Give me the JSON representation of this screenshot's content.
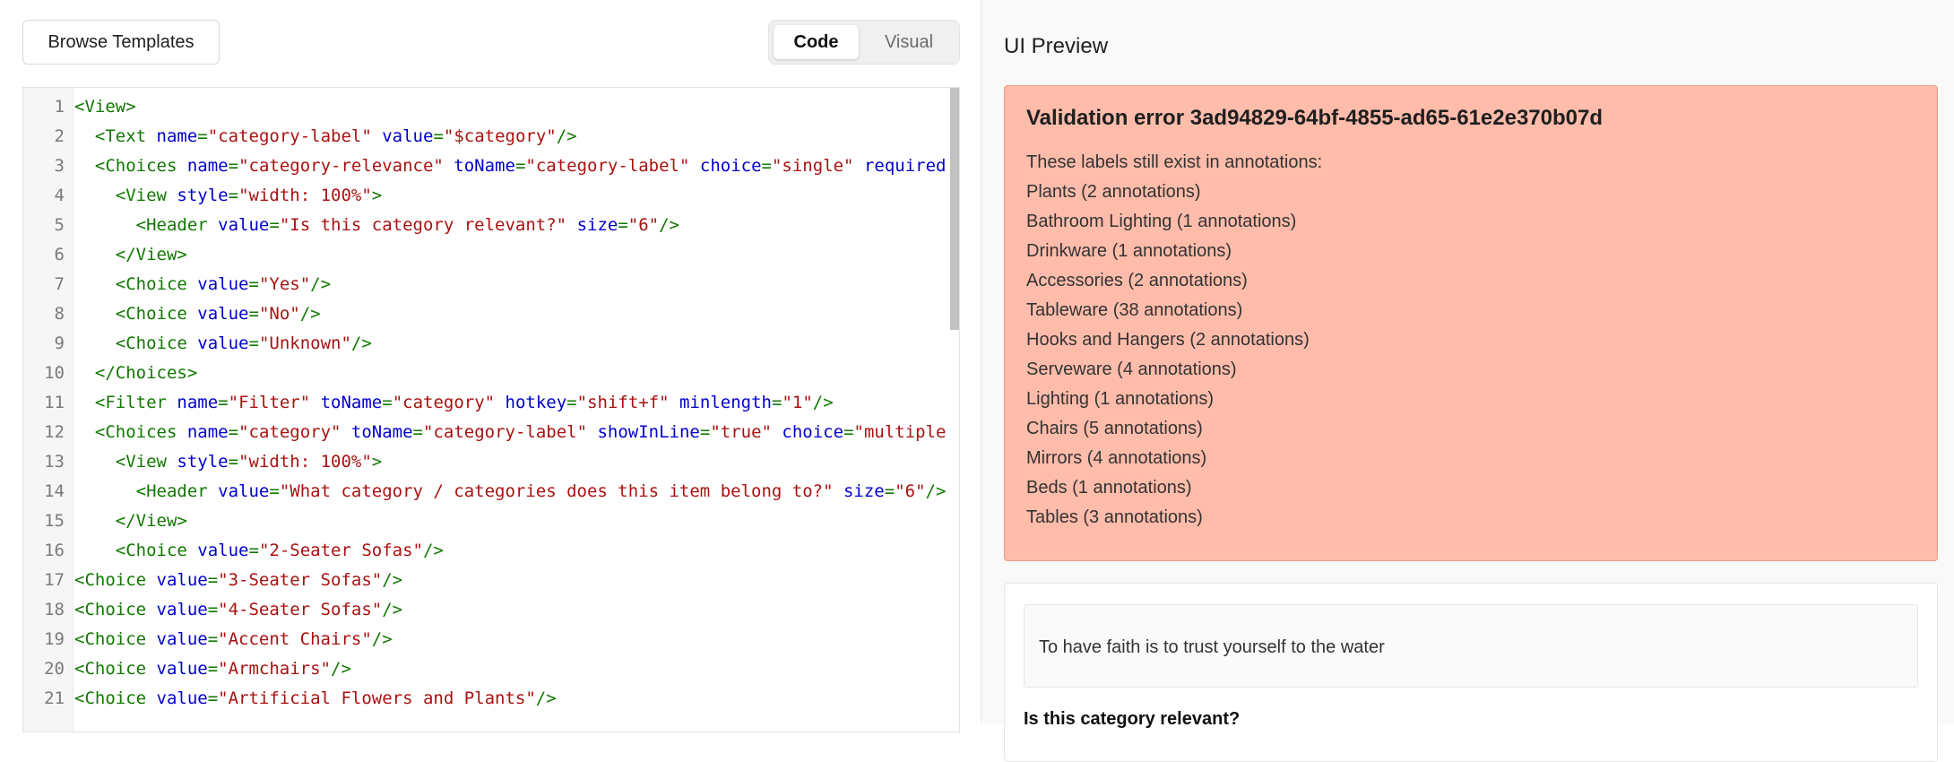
{
  "toolbar": {
    "browse_label": "Browse Templates",
    "mode_code_label": "Code",
    "mode_visual_label": "Visual"
  },
  "editor": {
    "lines": [
      {
        "num": "1",
        "indent": "",
        "tokens": [
          {
            "t": "tag",
            "v": "<View>"
          }
        ]
      },
      {
        "num": "2",
        "indent": "  ",
        "tokens": [
          {
            "t": "tag",
            "v": "<Text "
          },
          {
            "t": "attr",
            "v": "name"
          },
          {
            "t": "tag",
            "v": "="
          },
          {
            "t": "str",
            "v": "\"category-label\""
          },
          {
            "t": "tag",
            "v": " "
          },
          {
            "t": "attr",
            "v": "value"
          },
          {
            "t": "tag",
            "v": "="
          },
          {
            "t": "str",
            "v": "\"$category\""
          },
          {
            "t": "tag",
            "v": "/>"
          }
        ]
      },
      {
        "num": "3",
        "indent": "  ",
        "tokens": [
          {
            "t": "tag",
            "v": "<Choices "
          },
          {
            "t": "attr",
            "v": "name"
          },
          {
            "t": "tag",
            "v": "="
          },
          {
            "t": "str",
            "v": "\"category-relevance\""
          },
          {
            "t": "tag",
            "v": " "
          },
          {
            "t": "attr",
            "v": "toName"
          },
          {
            "t": "tag",
            "v": "="
          },
          {
            "t": "str",
            "v": "\"category-label\""
          },
          {
            "t": "tag",
            "v": " "
          },
          {
            "t": "attr",
            "v": "choice"
          },
          {
            "t": "tag",
            "v": "="
          },
          {
            "t": "str",
            "v": "\"single\""
          },
          {
            "t": "tag",
            "v": " "
          },
          {
            "t": "attr",
            "v": "required"
          }
        ]
      },
      {
        "num": "4",
        "indent": "    ",
        "tokens": [
          {
            "t": "tag",
            "v": "<View "
          },
          {
            "t": "attr",
            "v": "style"
          },
          {
            "t": "tag",
            "v": "="
          },
          {
            "t": "str",
            "v": "\"width: 100%\""
          },
          {
            "t": "tag",
            "v": ">"
          }
        ]
      },
      {
        "num": "5",
        "indent": "      ",
        "tokens": [
          {
            "t": "tag",
            "v": "<Header "
          },
          {
            "t": "attr",
            "v": "value"
          },
          {
            "t": "tag",
            "v": "="
          },
          {
            "t": "str",
            "v": "\"Is this category relevant?\""
          },
          {
            "t": "tag",
            "v": " "
          },
          {
            "t": "attr",
            "v": "size"
          },
          {
            "t": "tag",
            "v": "="
          },
          {
            "t": "str",
            "v": "\"6\""
          },
          {
            "t": "tag",
            "v": "/>"
          }
        ]
      },
      {
        "num": "6",
        "indent": "    ",
        "tokens": [
          {
            "t": "tag",
            "v": "</View>"
          }
        ]
      },
      {
        "num": "7",
        "indent": "    ",
        "tokens": [
          {
            "t": "tag",
            "v": "<Choice "
          },
          {
            "t": "attr",
            "v": "value"
          },
          {
            "t": "tag",
            "v": "="
          },
          {
            "t": "str",
            "v": "\"Yes\""
          },
          {
            "t": "tag",
            "v": "/>"
          }
        ]
      },
      {
        "num": "8",
        "indent": "    ",
        "tokens": [
          {
            "t": "tag",
            "v": "<Choice "
          },
          {
            "t": "attr",
            "v": "value"
          },
          {
            "t": "tag",
            "v": "="
          },
          {
            "t": "str",
            "v": "\"No\""
          },
          {
            "t": "tag",
            "v": "/>"
          }
        ]
      },
      {
        "num": "9",
        "indent": "    ",
        "tokens": [
          {
            "t": "tag",
            "v": "<Choice "
          },
          {
            "t": "attr",
            "v": "value"
          },
          {
            "t": "tag",
            "v": "="
          },
          {
            "t": "str",
            "v": "\"Unknown\""
          },
          {
            "t": "tag",
            "v": "/>"
          }
        ]
      },
      {
        "num": "10",
        "indent": "  ",
        "tokens": [
          {
            "t": "tag",
            "v": "</Choices>"
          }
        ]
      },
      {
        "num": "11",
        "indent": "  ",
        "tokens": [
          {
            "t": "tag",
            "v": "<Filter "
          },
          {
            "t": "attr",
            "v": "name"
          },
          {
            "t": "tag",
            "v": "="
          },
          {
            "t": "str",
            "v": "\"Filter\""
          },
          {
            "t": "tag",
            "v": " "
          },
          {
            "t": "attr",
            "v": "toName"
          },
          {
            "t": "tag",
            "v": "="
          },
          {
            "t": "str",
            "v": "\"category\""
          },
          {
            "t": "tag",
            "v": " "
          },
          {
            "t": "attr",
            "v": "hotkey"
          },
          {
            "t": "tag",
            "v": "="
          },
          {
            "t": "str",
            "v": "\"shift+f\""
          },
          {
            "t": "tag",
            "v": " "
          },
          {
            "t": "attr",
            "v": "minlength"
          },
          {
            "t": "tag",
            "v": "="
          },
          {
            "t": "str",
            "v": "\"1\""
          },
          {
            "t": "tag",
            "v": "/>"
          }
        ]
      },
      {
        "num": "12",
        "indent": "  ",
        "tokens": [
          {
            "t": "tag",
            "v": "<Choices "
          },
          {
            "t": "attr",
            "v": "name"
          },
          {
            "t": "tag",
            "v": "="
          },
          {
            "t": "str",
            "v": "\"category\""
          },
          {
            "t": "tag",
            "v": " "
          },
          {
            "t": "attr",
            "v": "toName"
          },
          {
            "t": "tag",
            "v": "="
          },
          {
            "t": "str",
            "v": "\"category-label\""
          },
          {
            "t": "tag",
            "v": " "
          },
          {
            "t": "attr",
            "v": "showInLine"
          },
          {
            "t": "tag",
            "v": "="
          },
          {
            "t": "str",
            "v": "\"true\""
          },
          {
            "t": "tag",
            "v": " "
          },
          {
            "t": "attr",
            "v": "choice"
          },
          {
            "t": "tag",
            "v": "="
          },
          {
            "t": "str",
            "v": "\"multiple"
          }
        ]
      },
      {
        "num": "13",
        "indent": "    ",
        "tokens": [
          {
            "t": "tag",
            "v": "<View "
          },
          {
            "t": "attr",
            "v": "style"
          },
          {
            "t": "tag",
            "v": "="
          },
          {
            "t": "str",
            "v": "\"width: 100%\""
          },
          {
            "t": "tag",
            "v": ">"
          }
        ]
      },
      {
        "num": "14",
        "indent": "      ",
        "tokens": [
          {
            "t": "tag",
            "v": "<Header "
          },
          {
            "t": "attr",
            "v": "value"
          },
          {
            "t": "tag",
            "v": "="
          },
          {
            "t": "str",
            "v": "\"What category / categories does this item belong to?\""
          },
          {
            "t": "tag",
            "v": " "
          },
          {
            "t": "attr",
            "v": "size"
          },
          {
            "t": "tag",
            "v": "="
          },
          {
            "t": "str",
            "v": "\"6\""
          },
          {
            "t": "tag",
            "v": "/>"
          }
        ]
      },
      {
        "num": "15",
        "indent": "    ",
        "tokens": [
          {
            "t": "tag",
            "v": "</View>"
          }
        ]
      },
      {
        "num": "16",
        "indent": "    ",
        "tokens": [
          {
            "t": "tag",
            "v": "<Choice "
          },
          {
            "t": "attr",
            "v": "value"
          },
          {
            "t": "tag",
            "v": "="
          },
          {
            "t": "str",
            "v": "\"2-Seater Sofas\""
          },
          {
            "t": "tag",
            "v": "/>"
          }
        ]
      },
      {
        "num": "17",
        "indent": "",
        "tokens": [
          {
            "t": "tag",
            "v": "<Choice "
          },
          {
            "t": "attr",
            "v": "value"
          },
          {
            "t": "tag",
            "v": "="
          },
          {
            "t": "str",
            "v": "\"3-Seater Sofas\""
          },
          {
            "t": "tag",
            "v": "/>"
          }
        ]
      },
      {
        "num": "18",
        "indent": "",
        "tokens": [
          {
            "t": "tag",
            "v": "<Choice "
          },
          {
            "t": "attr",
            "v": "value"
          },
          {
            "t": "tag",
            "v": "="
          },
          {
            "t": "str",
            "v": "\"4-Seater Sofas\""
          },
          {
            "t": "tag",
            "v": "/>"
          }
        ]
      },
      {
        "num": "19",
        "indent": "",
        "tokens": [
          {
            "t": "tag",
            "v": "<Choice "
          },
          {
            "t": "attr",
            "v": "value"
          },
          {
            "t": "tag",
            "v": "="
          },
          {
            "t": "str",
            "v": "\"Accent Chairs\""
          },
          {
            "t": "tag",
            "v": "/>"
          }
        ]
      },
      {
        "num": "20",
        "indent": "",
        "tokens": [
          {
            "t": "tag",
            "v": "<Choice "
          },
          {
            "t": "attr",
            "v": "value"
          },
          {
            "t": "tag",
            "v": "="
          },
          {
            "t": "str",
            "v": "\"Armchairs\""
          },
          {
            "t": "tag",
            "v": "/>"
          }
        ]
      },
      {
        "num": "21",
        "indent": "",
        "tokens": [
          {
            "t": "tag",
            "v": "<Choice "
          },
          {
            "t": "attr",
            "v": "value"
          },
          {
            "t": "tag",
            "v": "="
          },
          {
            "t": "str",
            "v": "\"Artificial Flowers and Plants\""
          },
          {
            "t": "tag",
            "v": "/>"
          }
        ]
      }
    ]
  },
  "preview": {
    "title": "UI Preview",
    "error": {
      "title": "Validation error 3ad94829-64bf-4855-ad65-61e2e370b07d",
      "message": "These labels still exist in annotations:",
      "items": [
        "Plants (2 annotations)",
        "Bathroom Lighting (1 annotations)",
        "Drinkware (1 annotations)",
        "Accessories (2 annotations)",
        "Tableware (38 annotations)",
        "Hooks and Hangers (2 annotations)",
        "Serveware (4 annotations)",
        "Lighting (1 annotations)",
        "Chairs (5 annotations)",
        "Mirrors (4 annotations)",
        "Beds (1 annotations)",
        "Tables (3 annotations)"
      ]
    },
    "task_text": "To have faith is to trust yourself to the water",
    "question": "Is this category relevant?"
  },
  "colors": {
    "error_bg": "#ffbcaa",
    "code_tag": "#117700",
    "code_attr": "#0000cc",
    "code_string": "#aa1111"
  }
}
